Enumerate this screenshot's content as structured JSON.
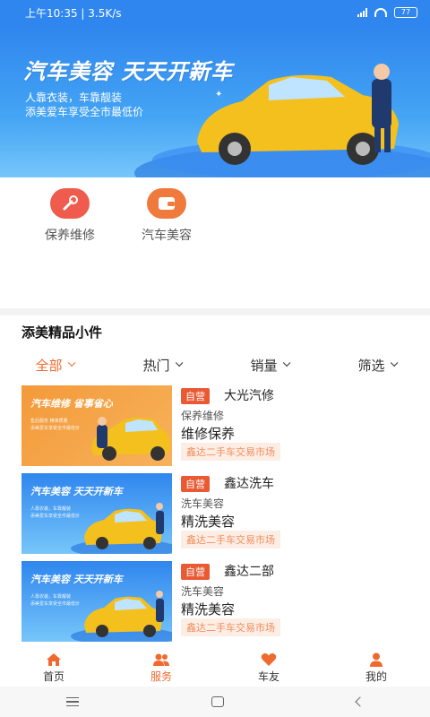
{
  "status_bar": {
    "time_speed": "上午10:35 | 3.5K/s",
    "battery": "77"
  },
  "banner": {
    "title": "汽车美容  天天开新车",
    "line1": "人靠衣装，车靠靓装",
    "line2": "添美爱车享受全市最低价"
  },
  "services": [
    {
      "label": "保养维修",
      "icon": "wrench-icon",
      "color": "#ef5b4c"
    },
    {
      "label": "汽车美容",
      "icon": "wallet-icon",
      "color": "#f07a3c"
    }
  ],
  "section_title": "添美精品小件",
  "filters": [
    {
      "label": "全部",
      "active": true
    },
    {
      "label": "热门",
      "active": false
    },
    {
      "label": "销量",
      "active": false
    },
    {
      "label": "筛选",
      "active": false
    }
  ],
  "items": [
    {
      "tag": "自营",
      "shop": "大光汽修",
      "category": "保养维修",
      "service": "维修保养",
      "address": "鑫达二手车交易市场",
      "thumb_title": "汽车维修  省事省心",
      "thumb_line1": "售后服务  精准质量",
      "thumb_line2": "添美爱车享受全市最低价"
    },
    {
      "tag": "自营",
      "shop": "鑫达洗车",
      "category": "洗车美容",
      "service": "精洗美容",
      "address": "鑫达二手车交易市场",
      "thumb_title": "汽车美容  天天开新车",
      "thumb_line1": "人靠衣装，车靠靓装",
      "thumb_line2": "添美爱车享受全市最低价"
    },
    {
      "tag": "自营",
      "shop": "鑫达二部",
      "category": "洗车美容",
      "service": "精洗美容",
      "address": "鑫达二手车交易市场",
      "thumb_title": "汽车美容  天天开新车",
      "thumb_line1": "人靠衣装，车靠靓装",
      "thumb_line2": "添美爱车享受全市最低价"
    }
  ],
  "tabbar": [
    {
      "label": "首页",
      "icon": "home-icon",
      "active": false
    },
    {
      "label": "服务",
      "icon": "users-icon",
      "active": true
    },
    {
      "label": "车友",
      "icon": "heart-icon",
      "active": false
    },
    {
      "label": "我的",
      "icon": "person-icon",
      "active": false
    }
  ],
  "colors": {
    "accent": "#ef6a2e",
    "banner_blue": "#2f86ee",
    "tag_red": "#e95a34"
  }
}
